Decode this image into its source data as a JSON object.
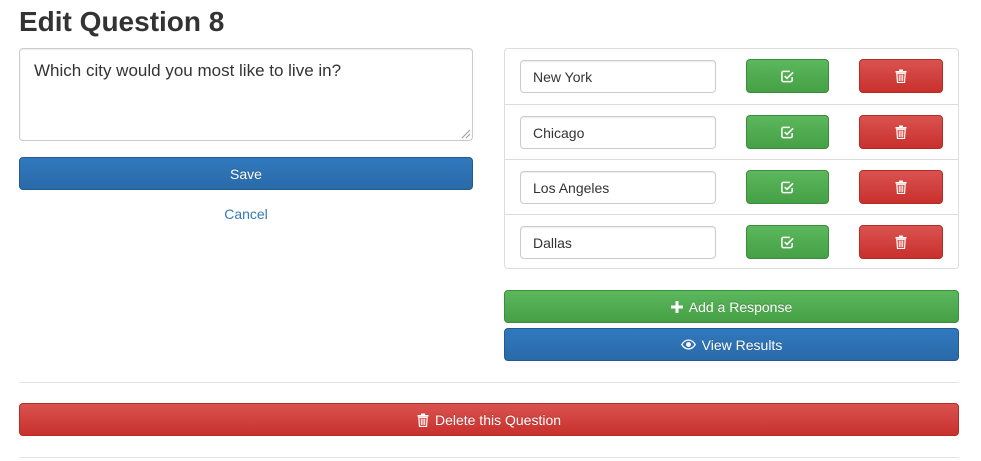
{
  "page": {
    "title": "Edit Question 8"
  },
  "question": {
    "text": "Which city would you most like to live in?"
  },
  "actions": {
    "save_label": "Save",
    "cancel_label": "Cancel"
  },
  "responses": [
    {
      "value": "New York"
    },
    {
      "value": "Chicago"
    },
    {
      "value": "Los Angeles"
    },
    {
      "value": "Dallas"
    }
  ],
  "response_actions": {
    "add_label": "Add a Response",
    "view_results_label": "View Results",
    "add_icon": "plus-icon",
    "results_icon": "eye-icon",
    "approve_icon": "check-square-icon",
    "delete_icon": "trash-icon"
  },
  "danger": {
    "delete_question_label": "Delete this Question",
    "icon": "trash-icon"
  },
  "colors": {
    "primary": "#2a6aa8",
    "success": "#5cb85c",
    "danger": "#d9534f",
    "link": "#337ab7"
  }
}
